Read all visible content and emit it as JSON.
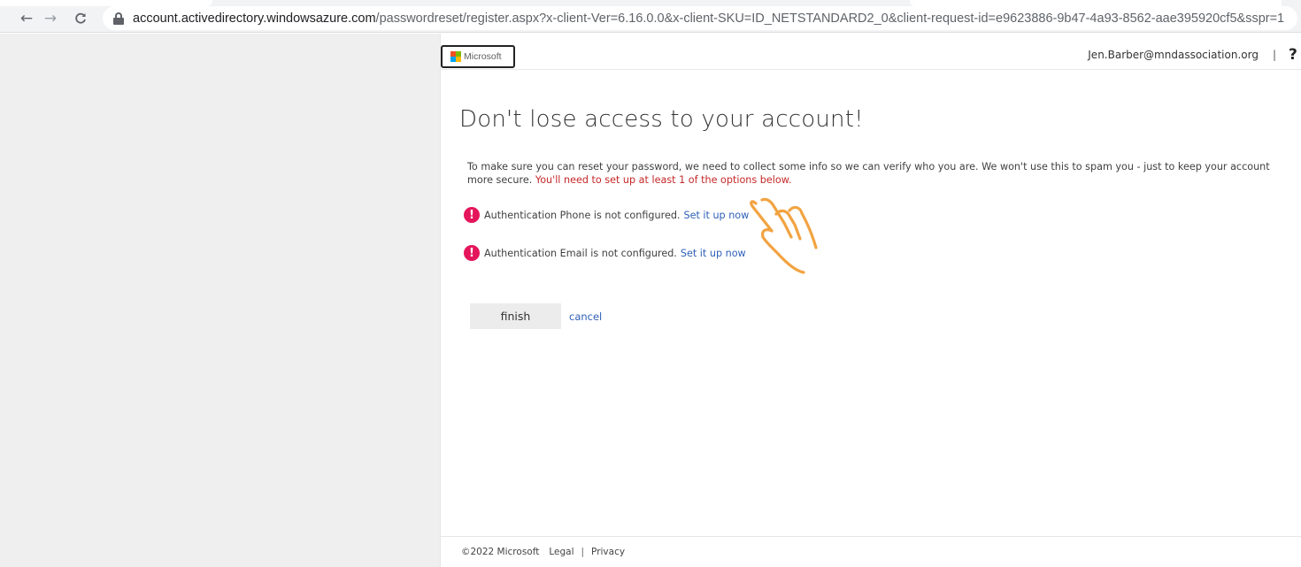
{
  "browser": {
    "url_host": "account.activedirectory.windowsazure.com",
    "url_rest": "/passwordreset/register.aspx?x-client-Ver=6.16.0.0&x-client-SKU=ID_NETSTANDARD2_0&client-request-id=e9623886-9b47-4a93-8562-aae395920cf5&sspr=1",
    "back_icon": "arrow-left-icon",
    "forward_icon": "arrow-right-icon",
    "reload_icon": "reload-icon",
    "lock_icon": "lock-icon"
  },
  "header": {
    "logo_text": "Microsoft",
    "account_email": "Jen.Barber@mndassociation.org",
    "separator": "|",
    "help_label": "?"
  },
  "main": {
    "title": "Don't lose access to your account!",
    "intro_text": "To make sure you can reset your password, we need to collect some info so we can verify who you are. We won't use this to spam you - just to keep your account more secure. ",
    "intro_warning": "You'll need to set up at least 1 of the options below.",
    "items": [
      {
        "status_text": "Authentication Phone is not configured.",
        "link_label": "Set it up now",
        "icon": "alert-icon"
      },
      {
        "status_text": "Authentication Email is not configured.",
        "link_label": "Set it up now",
        "icon": "alert-icon"
      }
    ],
    "finish_label": "finish",
    "cancel_label": "cancel"
  },
  "footer": {
    "copyright": "©2022 Microsoft",
    "legal_label": "Legal",
    "separator": "|",
    "privacy_label": "Privacy"
  },
  "colors": {
    "alert": "#e4155b",
    "link": "#2e5fb7",
    "warning_text": "#c62828",
    "pointer_annotation": "#f2a341",
    "ms_red": "#f25022",
    "ms_green": "#7fba00",
    "ms_blue": "#00a4ef",
    "ms_yellow": "#ffb900"
  }
}
